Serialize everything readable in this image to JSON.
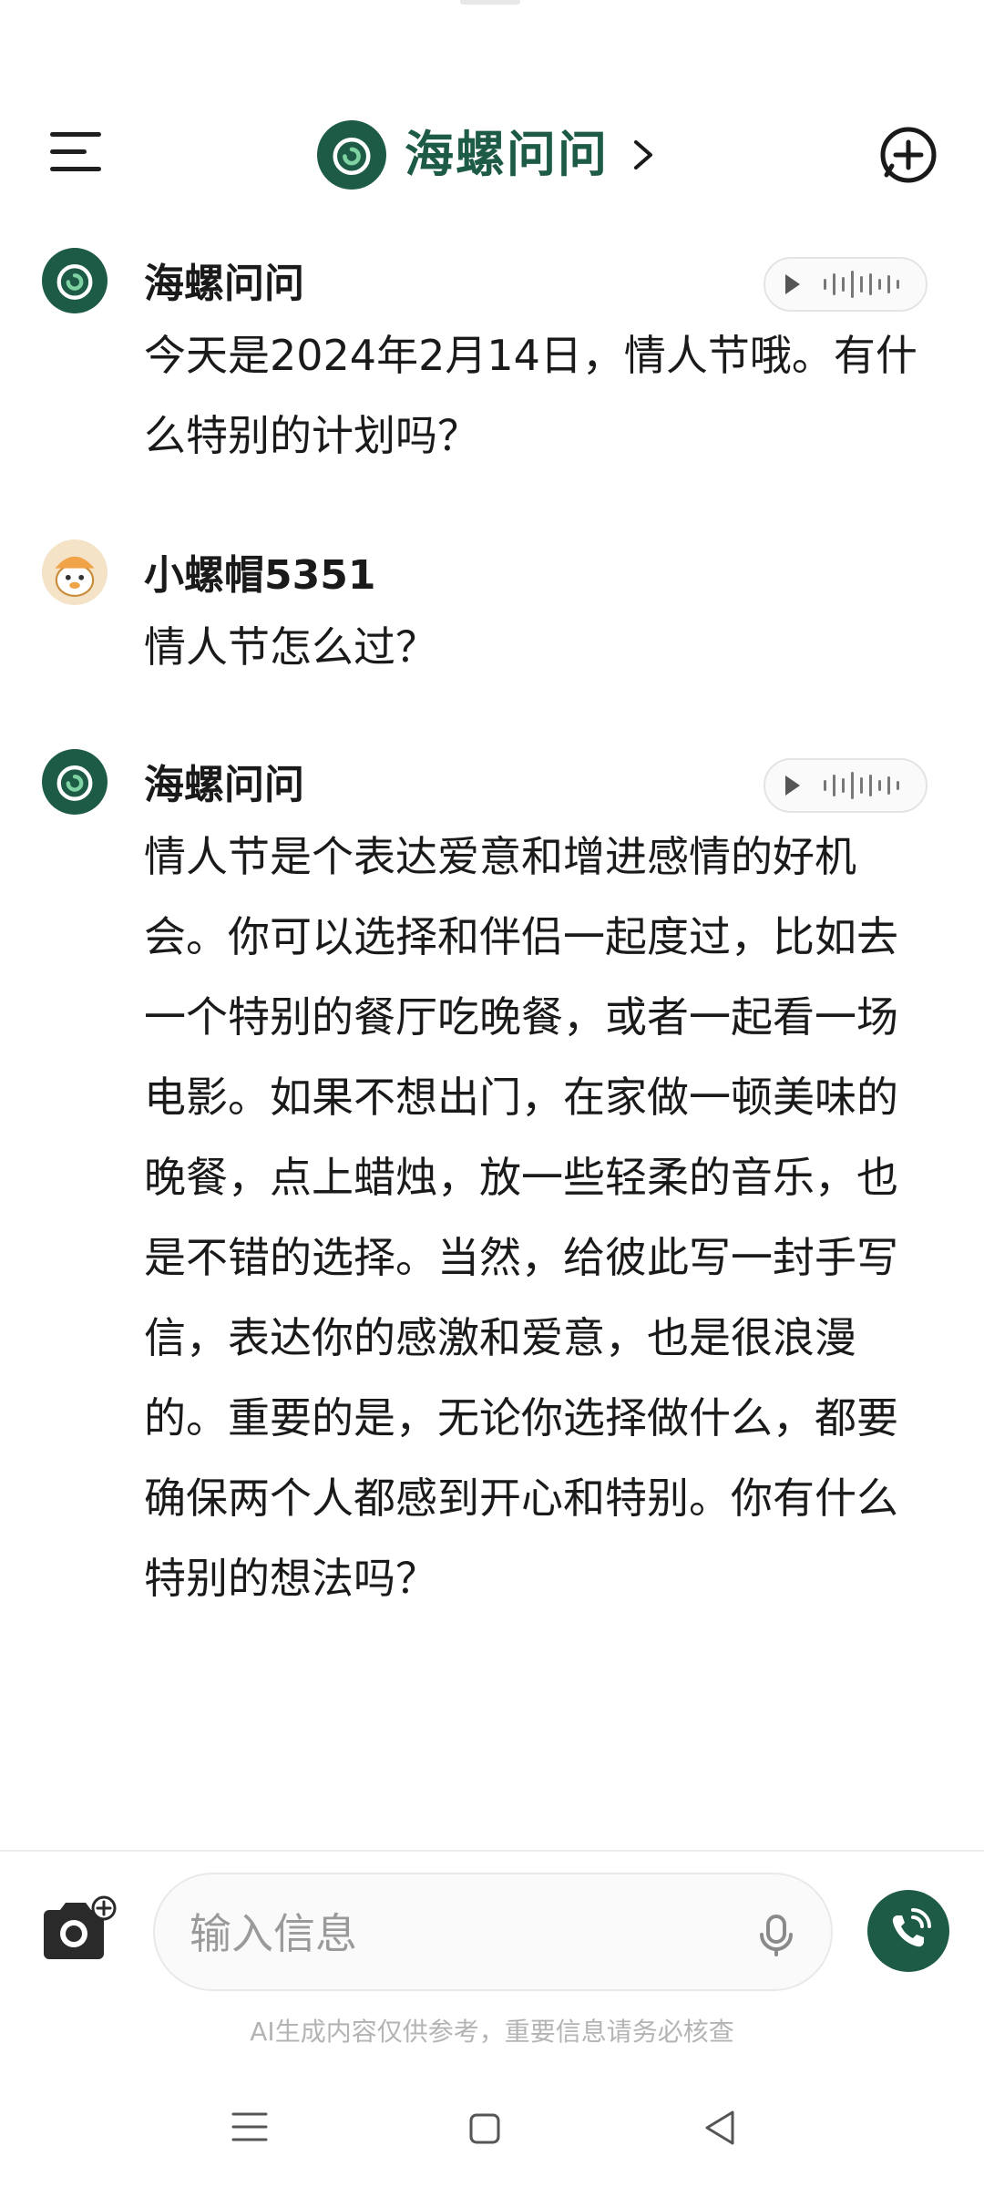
{
  "header": {
    "title": "海螺问问",
    "menu_icon": "hamburger-menu-icon",
    "new_chat_icon": "plus-circle-icon",
    "brand_color": "#1e5b47"
  },
  "messages": [
    {
      "sender": "海螺问问",
      "text": "今天是2024年2月14日，情人节哦。有什么特别的计划吗？",
      "role": "assistant"
    },
    {
      "sender": "小螺帽5351",
      "text": "情人节怎么过？",
      "role": "user"
    },
    {
      "sender": "海螺问问",
      "text": "情人节是个表达爱意和增进感情的好机会。你可以选择和伴侣一起度过，比如去一个特别的餐厅吃晚餐，或者一起看一场电影。如果不想出门，在家做一顿美味的晚餐，点上蜡烛，放一些轻柔的音乐，也是不错的选择。当然，给彼此写一封手写信，表达你的感激和爱意，也是很浪漫的。重要的是，无论你选择做什么，都要确保两个人都感到开心和特别。你有什么特别的想法吗？",
      "role": "assistant"
    }
  ],
  "message_actions": [
    "refresh-icon",
    "copy-icon",
    "share-icon"
  ],
  "input": {
    "placeholder": "输入信息",
    "value": ""
  },
  "disclaimer": "AI生成内容仅供参考，重要信息请务必核查",
  "nav": [
    "menu-icon",
    "home-icon",
    "back-icon"
  ]
}
